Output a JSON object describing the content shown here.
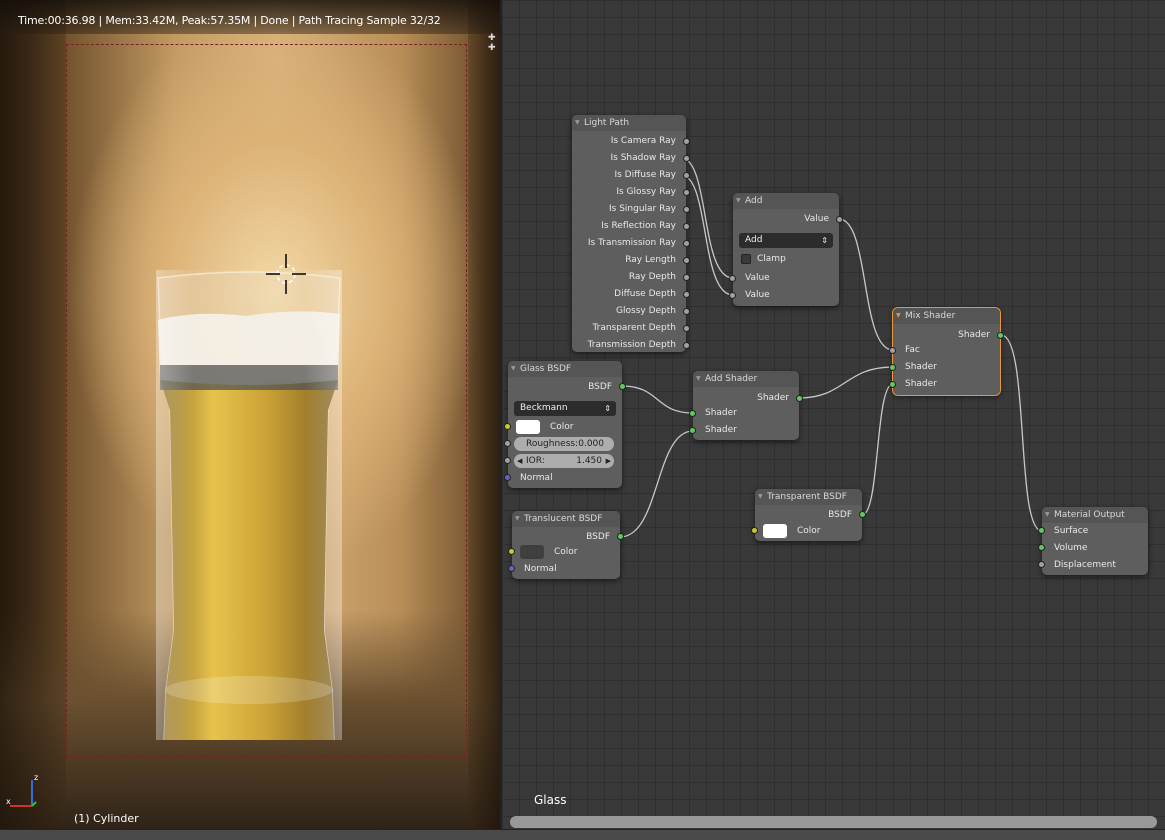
{
  "viewport": {
    "status": "Time:00:36.98 | Mem:33.42M, Peak:57.35M | Done | Path Tracing Sample 32/32",
    "object_name": "(1) Cylinder",
    "axis_x": "x",
    "axis_z": "z"
  },
  "node_editor": {
    "material_name": "Glass",
    "nodes": {
      "light_path": {
        "title": "Light Path",
        "outputs": [
          "Is Camera Ray",
          "Is Shadow Ray",
          "Is Diffuse Ray",
          "Is Glossy Ray",
          "Is Singular Ray",
          "Is Reflection Ray",
          "Is Transmission Ray",
          "Ray Length",
          "Ray Depth",
          "Diffuse Depth",
          "Glossy Depth",
          "Transparent Depth",
          "Transmission Depth"
        ]
      },
      "add": {
        "title": "Add",
        "output": "Value",
        "operation": "Add",
        "clamp_label": "Clamp",
        "input1": "Value",
        "input2": "Value"
      },
      "mix_shader": {
        "title": "Mix Shader",
        "output": "Shader",
        "input_fac": "Fac",
        "input_shader1": "Shader",
        "input_shader2": "Shader"
      },
      "glass_bsdf": {
        "title": "Glass BSDF",
        "output": "BSDF",
        "distribution": "Beckmann",
        "color_label": "Color",
        "roughness_label": "Roughness:",
        "roughness_value": "0.000",
        "ior_label": "IOR:",
        "ior_value": "1.450",
        "normal_label": "Normal"
      },
      "add_shader": {
        "title": "Add Shader",
        "output": "Shader",
        "input1": "Shader",
        "input2": "Shader"
      },
      "translucent_bsdf": {
        "title": "Translucent BSDF",
        "output": "BSDF",
        "color_label": "Color",
        "normal_label": "Normal"
      },
      "transparent_bsdf": {
        "title": "Transparent BSDF",
        "output": "BSDF",
        "color_label": "Color"
      },
      "material_output": {
        "title": "Material Output",
        "inputs": [
          "Surface",
          "Volume",
          "Displacement"
        ]
      }
    }
  },
  "colors": {
    "socket_shader": "#63c763",
    "socket_value": "#a1a1a1",
    "socket_color": "#c7c729",
    "socket_vector": "#6363c7",
    "active_node_outline": "#e9953c"
  }
}
